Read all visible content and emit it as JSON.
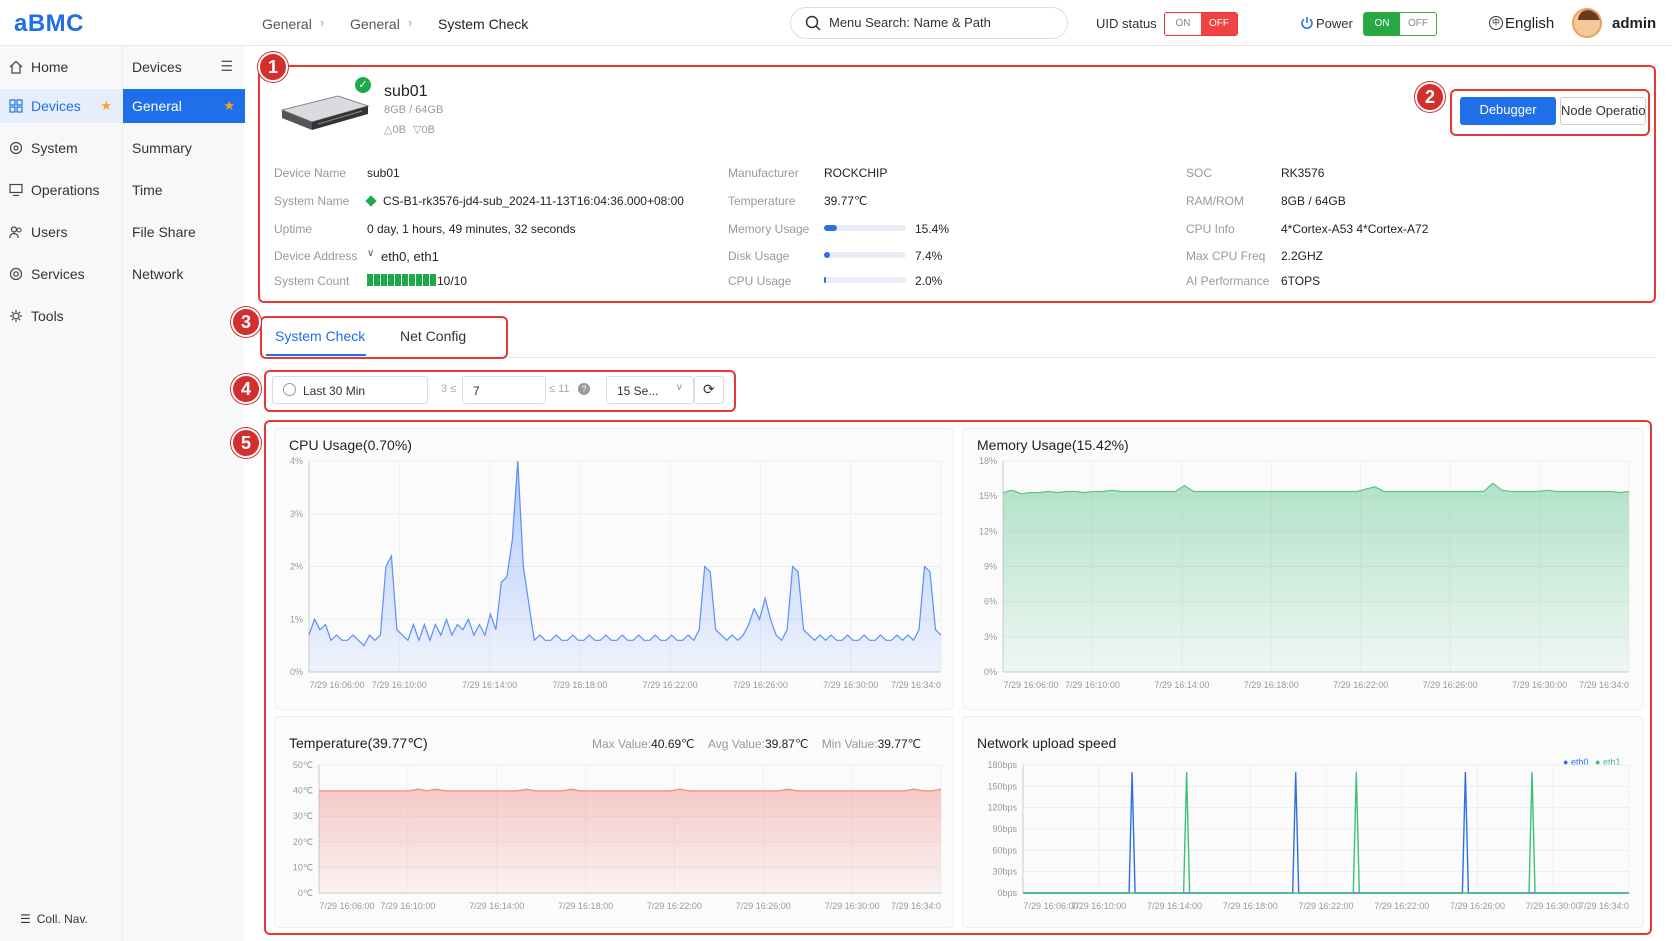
{
  "app": {
    "logo": "aBMC"
  },
  "breadcrumb": [
    "General",
    "General",
    "System Check"
  ],
  "search": {
    "placeholder": "Menu Search: Name & Path"
  },
  "uid_status": {
    "label": "UID status",
    "on": "ON",
    "off": "OFF",
    "state": "off"
  },
  "power": {
    "label": "Power",
    "on": "ON",
    "off": "OFF",
    "state": "on"
  },
  "language": "English",
  "user": "admin",
  "sidebar": {
    "items": [
      {
        "label": "Home",
        "icon": "home-icon"
      },
      {
        "label": "Devices",
        "icon": "devices-icon",
        "active": true
      },
      {
        "label": "System",
        "icon": "system-icon"
      },
      {
        "label": "Operations",
        "icon": "operations-icon"
      },
      {
        "label": "Users",
        "icon": "users-icon"
      },
      {
        "label": "Services",
        "icon": "services-icon"
      },
      {
        "label": "Tools",
        "icon": "tools-icon"
      }
    ],
    "collapse_label": "Coll. Nav."
  },
  "subnav": {
    "header": "Devices",
    "items": [
      "General",
      "Summary",
      "Time",
      "File Share",
      "Network"
    ]
  },
  "device": {
    "name": "sub01",
    "memory": "8GB / 64GB",
    "traffic_up": "0B",
    "traffic_down": "0B",
    "fields": {
      "device_name": {
        "label": "Device Name",
        "value": "sub01"
      },
      "system_name": {
        "label": "System Name",
        "value": "CS-B1-rk3576-jd4-sub_2024-11-13T16:04:36.000+08:00"
      },
      "uptime": {
        "label": "Uptime",
        "value": "0 day, 1 hours, 49 minutes, 32 seconds"
      },
      "device_address": {
        "label": "Device Address",
        "value": "eth0, eth1"
      },
      "system_count": {
        "label": "System Count",
        "value": "10/10",
        "filled": 10,
        "total": 10
      },
      "manufacturer": {
        "label": "Manufacturer",
        "value": "ROCKCHIP"
      },
      "temperature": {
        "label": "Temperature",
        "value": "39.77℃"
      },
      "memory_usage": {
        "label": "Memory Usage",
        "value": "15.4%",
        "fraction": 0.154
      },
      "disk_usage": {
        "label": "Disk Usage",
        "value": "7.4%",
        "fraction": 0.074
      },
      "cpu_usage": {
        "label": "CPU Usage",
        "value": "2.0%",
        "fraction": 0.02
      },
      "soc": {
        "label": "SOC",
        "value": "RK3576"
      },
      "ram_rom": {
        "label": "RAM/ROM",
        "value": "8GB / 64GB"
      },
      "cpu_info": {
        "label": "CPU Info",
        "value": "4*Cortex-A53 4*Cortex-A72"
      },
      "max_cpu_freq": {
        "label": "Max CPU Freq",
        "value": "2.2GHZ"
      },
      "ai_performance": {
        "label": "AI Performance",
        "value": "6TOPS"
      }
    }
  },
  "actions": {
    "debugger": "Debugger",
    "node_operation": "Node Operation"
  },
  "annotations": [
    "1",
    "2",
    "3",
    "4",
    "5"
  ],
  "tabs": [
    "System Check",
    "Net Config"
  ],
  "filters": {
    "time_range": "Last 30 Min",
    "min_prefix": "3 ≤",
    "points": "7",
    "max_suffix": "≤ 11",
    "interval": "15 Se..."
  },
  "chart_data": [
    {
      "type": "area",
      "title": "CPU Usage(0.70%)",
      "x_ticks": [
        "7/29 16:06:00",
        "7/29 16:10:00",
        "7/29 16:14:00",
        "7/29 16:18:00",
        "7/29 16:22:00",
        "7/29 16:26:00",
        "7/29 16:30:00",
        "7/29 16:34:0"
      ],
      "y_ticks": [
        "0%",
        "1%",
        "2%",
        "3%",
        "4%"
      ],
      "ylim": [
        0,
        4
      ],
      "color": "#5b8ff9",
      "series": [
        {
          "values": [
            0.7,
            1.0,
            0.8,
            0.9,
            0.6,
            0.7,
            0.6,
            0.6,
            0.7,
            0.6,
            0.5,
            0.7,
            0.6,
            0.7,
            2.0,
            2.2,
            0.8,
            0.7,
            0.6,
            0.9,
            0.6,
            0.9,
            0.6,
            0.9,
            0.7,
            1.0,
            0.7,
            0.9,
            0.8,
            1.0,
            0.7,
            0.9,
            0.7,
            1.1,
            0.8,
            1.7,
            1.8,
            2.5,
            4.0,
            2.0,
            1.3,
            0.6,
            0.7,
            0.6,
            0.6,
            0.7,
            0.6,
            0.6,
            0.7,
            0.6,
            0.6,
            0.7,
            0.6,
            0.6,
            0.7,
            0.6,
            0.6,
            0.7,
            0.6,
            0.6,
            0.7,
            0.6,
            0.6,
            0.7,
            0.6,
            0.6,
            0.7,
            0.6,
            0.6,
            0.7,
            0.6,
            0.8,
            2.0,
            1.9,
            0.8,
            0.7,
            0.6,
            0.7,
            0.6,
            0.7,
            0.9,
            1.2,
            1.0,
            1.4,
            1.0,
            0.7,
            0.6,
            0.8,
            2.0,
            1.9,
            0.8,
            0.7,
            0.6,
            0.7,
            0.6,
            0.7,
            0.6,
            0.6,
            0.7,
            0.6,
            0.6,
            0.7,
            0.6,
            0.6,
            0.7,
            0.6,
            0.6,
            0.7,
            0.6,
            0.7,
            0.6,
            0.8,
            2.0,
            1.9,
            0.8,
            0.7
          ]
        }
      ]
    },
    {
      "type": "area",
      "title": "Memory Usage(15.42%)",
      "x_ticks": [
        "7/29 16:06:00",
        "7/29 16:10:00",
        "7/29 16:14:00",
        "7/29 16:18:00",
        "7/29 16:22:00",
        "7/29 16:26:00",
        "7/29 16:30:00",
        "7/29 16:34:0"
      ],
      "y_ticks": [
        "0%",
        "3%",
        "6%",
        "9%",
        "12%",
        "15%",
        "18%"
      ],
      "ylim": [
        0,
        18
      ],
      "color": "#5ac38a",
      "series": [
        {
          "values": [
            15.3,
            15.5,
            15.2,
            15.3,
            15.3,
            15.4,
            15.3,
            15.4,
            15.4,
            15.3,
            15.4,
            15.4,
            15.5,
            15.4,
            15.4,
            15.4,
            15.4,
            15.4,
            15.4,
            15.4,
            15.9,
            15.4,
            15.4,
            15.4,
            15.4,
            15.4,
            15.4,
            15.4,
            15.4,
            15.4,
            15.4,
            15.4,
            15.4,
            15.4,
            15.4,
            15.4,
            15.4,
            15.4,
            15.4,
            15.4,
            15.6,
            15.8,
            15.4,
            15.4,
            15.4,
            15.4,
            15.4,
            15.4,
            15.4,
            15.4,
            15.4,
            15.4,
            15.4,
            15.4,
            16.1,
            15.5,
            15.4,
            15.4,
            15.4,
            15.4,
            15.5,
            15.4,
            15.4,
            15.4,
            15.4,
            15.4,
            15.4,
            15.4,
            15.3,
            15.4
          ]
        }
      ]
    },
    {
      "type": "area",
      "title": "Temperature(39.77℃)",
      "stats": {
        "max_label": "Max Value:",
        "max": "40.69℃",
        "avg_label": "Avg Value:",
        "avg": "39.87℃",
        "min_label": "Min Value:",
        "min": "39.77℃"
      },
      "x_ticks": [
        "7/29 16:06:00",
        "7/29 16:10:00",
        "7/29 16:14:00",
        "7/29 16:18:00",
        "7/29 16:22:00",
        "7/29 16:26:00",
        "7/29 16:30:00",
        "7/29 16:34:0"
      ],
      "y_ticks": [
        "0℃",
        "10℃",
        "20℃",
        "30℃",
        "40℃",
        "50℃"
      ],
      "ylim": [
        0,
        50
      ],
      "color": "#f08c84",
      "series": [
        {
          "values": [
            39.9,
            39.9,
            39.9,
            39.9,
            39.9,
            39.9,
            39.9,
            39.9,
            39.9,
            39.9,
            39.9,
            40.6,
            39.9,
            40.6,
            39.9,
            39.9,
            39.9,
            39.9,
            39.9,
            39.9,
            39.9,
            39.9,
            39.9,
            40.6,
            39.9,
            39.9,
            39.9,
            39.9,
            40.6,
            39.9,
            39.9,
            39.9,
            39.9,
            39.9,
            39.9,
            39.9,
            39.9,
            39.9,
            39.9,
            39.9,
            40.6,
            39.9,
            39.9,
            39.9,
            39.9,
            39.9,
            39.9,
            39.9,
            39.9,
            39.9,
            39.9,
            39.9,
            40.6,
            39.9,
            39.9,
            39.9,
            39.9,
            39.9,
            39.9,
            39.9,
            39.9,
            39.9,
            39.9,
            39.9,
            39.9,
            39.9,
            40.6,
            39.9,
            39.9,
            40.6
          ]
        }
      ]
    },
    {
      "type": "line",
      "title": "Network upload speed",
      "x_ticks": [
        "7/29 16:06:00",
        "7/29 16:10:00",
        "7/29 16:14:00",
        "7/29 16:18:00",
        "7/29 16:22:00",
        "7/29 16:22:00",
        "7/29 16:26:00",
        "7/29 16:30:00",
        "7/29 16:34:0"
      ],
      "y_ticks": [
        "0bps",
        "30bps",
        "60bps",
        "90bps",
        "120bps",
        "150bps",
        "180bps"
      ],
      "ylim": [
        0,
        180
      ],
      "legend_position": "top-right",
      "series": [
        {
          "name": "eth0",
          "color": "#2f6fe4",
          "spikes_at_fraction": [
            0.18,
            0.45,
            0.73
          ],
          "peak": 170
        },
        {
          "name": "eth1",
          "color": "#3cbf7d",
          "spikes_at_fraction": [
            0.27,
            0.55,
            0.84
          ],
          "peak": 170
        }
      ]
    }
  ]
}
